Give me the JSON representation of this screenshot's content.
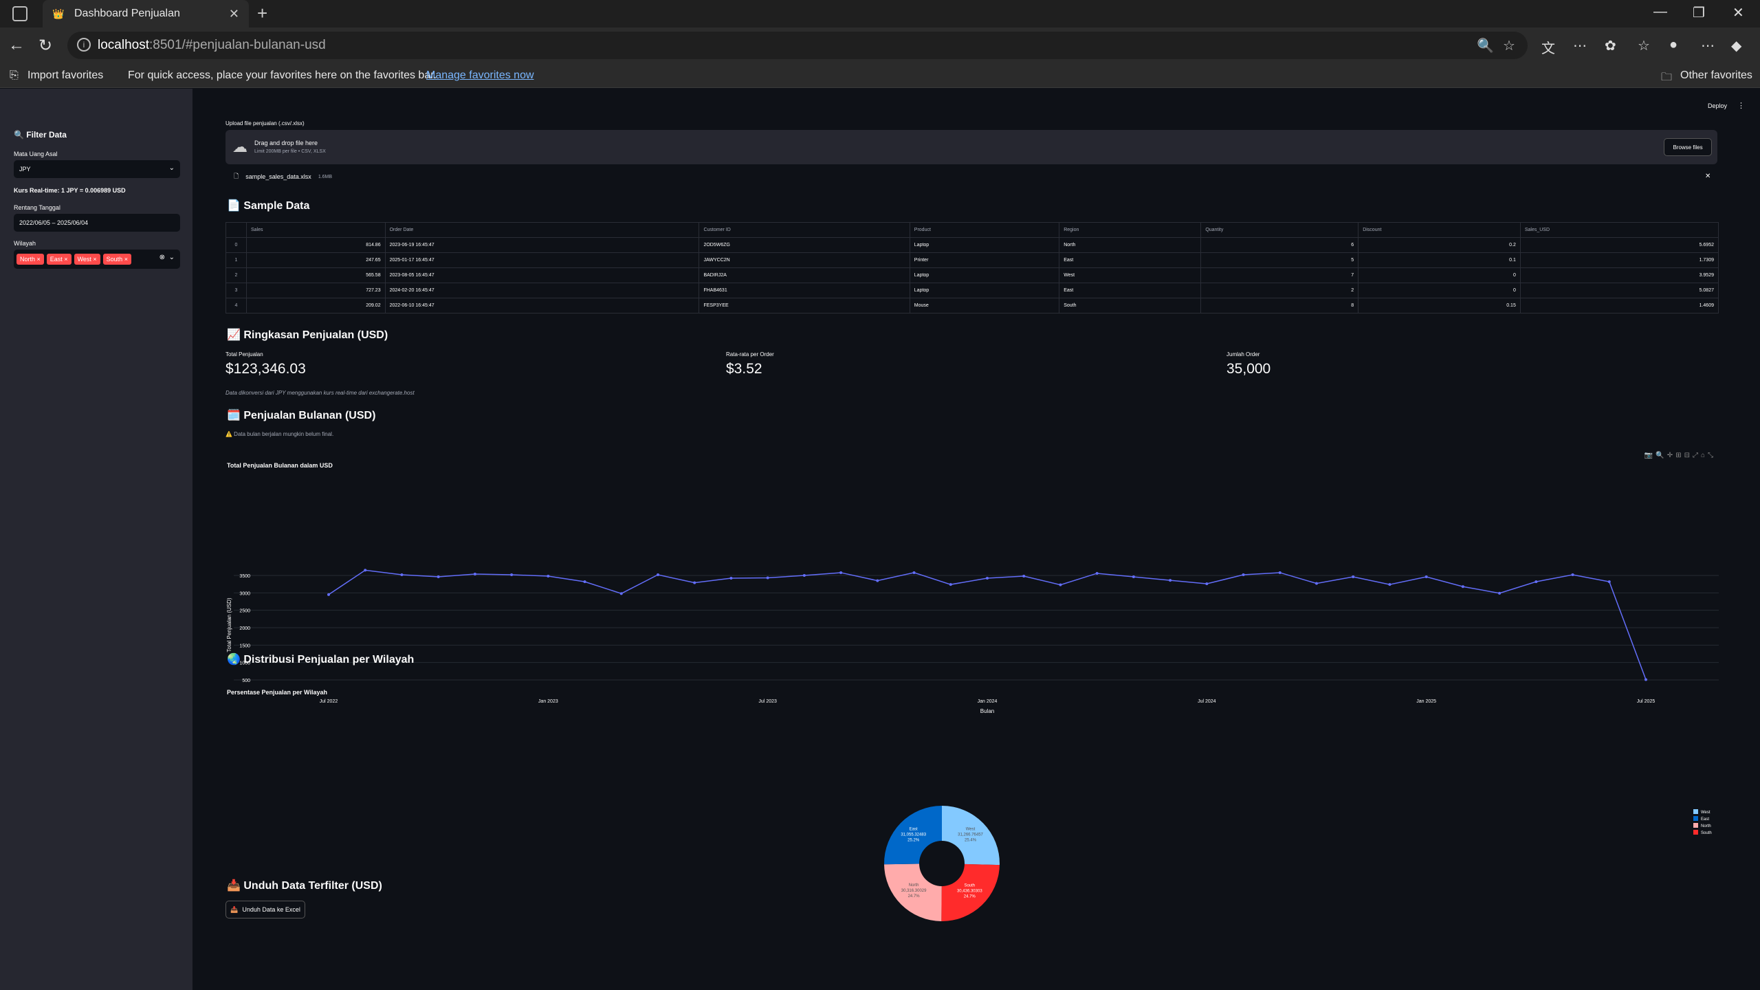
{
  "browser": {
    "tab_title": "Dashboard Penjualan",
    "url_host": "localhost",
    "url_path": ":8501/#penjualan-bulanan-usd",
    "import_favorites": "Import favorites",
    "fav_hint": "For quick access, place your favorites here on the favorites bar.",
    "manage_favorites": "Manage favorites now",
    "other_favorites": "Other favorites"
  },
  "sidebar": {
    "title": "🔍 Filter Data",
    "currency_label": "Mata Uang Asal",
    "currency_value": "JPY",
    "rate_text": "Kurs Real-time: 1 JPY = 0.006989 USD",
    "date_label": "Rentang Tanggal",
    "date_value": "2022/06/05 – 2025/06/04",
    "region_label": "Wilayah",
    "regions": [
      "North",
      "East",
      "West",
      "South"
    ]
  },
  "header": {
    "deploy": "Deploy"
  },
  "upload": {
    "label": "Upload file penjualan (.csv/.xlsx)",
    "drag_text": "Drag and drop file here",
    "limit_text": "Limit 200MB per file • CSV, XLSX",
    "browse": "Browse files",
    "file_name": "sample_sales_data.xlsx",
    "file_size": "1.6MB"
  },
  "sample": {
    "title": "📄 Sample Data",
    "columns": [
      "",
      "Sales",
      "Order Date",
      "Customer ID",
      "Product",
      "Region",
      "Quantity",
      "Discount",
      "Sales_USD"
    ],
    "rows": [
      [
        "0",
        "814.86",
        "2023-06-19 16:45:47",
        "2OD5W6ZG",
        "Laptop",
        "North",
        "6",
        "0.2",
        "5.6952"
      ],
      [
        "1",
        "247.65",
        "2025-01-17 16:45:47",
        "JAWYCC2N",
        "Printer",
        "East",
        "5",
        "0.1",
        "1.7309"
      ],
      [
        "2",
        "565.58",
        "2023-08-05 16:45:47",
        "BADIRJ2A",
        "Laptop",
        "West",
        "7",
        "0",
        "3.9529"
      ],
      [
        "3",
        "727.23",
        "2024-02-20 16:45:47",
        "FHAB4631",
        "Laptop",
        "East",
        "2",
        "0",
        "5.0827"
      ],
      [
        "4",
        "209.02",
        "2022-06-10 16:45:47",
        "FESP3YEE",
        "Mouse",
        "South",
        "8",
        "0.15",
        "1.4609"
      ]
    ]
  },
  "summary": {
    "title": "📈 Ringkasan Penjualan (USD)",
    "metrics": [
      {
        "label": "Total Penjualan",
        "value": "$123,346.03"
      },
      {
        "label": "Rata-rata per Order",
        "value": "$3.52"
      },
      {
        "label": "Jumlah Order",
        "value": "35,000"
      }
    ],
    "caption": "Data dikonversi dari JPY menggunakan kurs real-time dari exchangerate.host"
  },
  "monthly": {
    "title": "🗓️ Penjualan Bulanan (USD)",
    "warning": "⚠️ Data bulan berjalan mungkin belum final."
  },
  "region": {
    "title": "🌏 Distribusi Penjualan per Wilayah"
  },
  "download": {
    "title": "📥 Unduh Data Terfilter (USD)",
    "button": "Unduh Data ke Excel"
  },
  "chart_data": [
    {
      "type": "line",
      "title": "Total Penjualan Bulanan dalam USD",
      "xlabel": "Bulan",
      "ylabel": "Total Penjualan (USD)",
      "yticks": [
        500,
        1000,
        1500,
        2000,
        2500,
        3000,
        3500
      ],
      "ylim": [
        500,
        3800
      ],
      "xtick_labels": [
        "Jul 2022",
        "Jan 2023",
        "Jul 2023",
        "Jan 2024",
        "Jul 2024",
        "Jan 2025",
        "Jul 2025"
      ],
      "xtick_index": [
        0,
        6,
        12,
        18,
        24,
        30,
        36
      ],
      "color": "#636efa",
      "values": [
        2950,
        3650,
        3520,
        3460,
        3540,
        3520,
        3480,
        3320,
        2980,
        3520,
        3290,
        3420,
        3430,
        3500,
        3580,
        3350,
        3580,
        3240,
        3420,
        3480,
        3230,
        3560,
        3460,
        3360,
        3260,
        3520,
        3580,
        3270,
        3460,
        3240,
        3460,
        3180,
        2990,
        3320,
        3520,
        3320,
        510
      ]
    },
    {
      "type": "pie",
      "title": "Persentase Penjualan per Wilayah",
      "legend_position": "right",
      "slices": [
        {
          "label": "West",
          "value": 31266.76457,
          "percent": "25.4%",
          "color": "#83c9ff"
        },
        {
          "label": "South",
          "value": 30436.30303,
          "percent": "24.7%",
          "color": "#ff2b2b"
        },
        {
          "label": "North",
          "value": 30316.30029,
          "percent": "24.7%",
          "color": "#ffabab"
        },
        {
          "label": "East",
          "value": 31055.32483,
          "percent": "25.2%",
          "color": "#0068c9"
        }
      ]
    }
  ]
}
